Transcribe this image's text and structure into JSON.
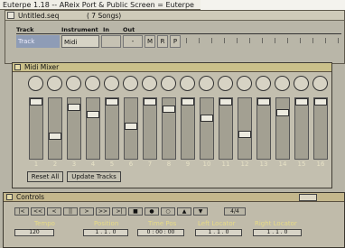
{
  "titlebar": {
    "text": "Euterpe 1.18 -- AReix Port & Public Screen = Euterpe"
  },
  "sequence_window": {
    "title": "Untitled.seq",
    "song_count": "( 7 Songs)",
    "columns": {
      "track": "Track",
      "instrument": "Instrument",
      "in": "In",
      "out": "Out"
    },
    "row": {
      "track_name": "Track",
      "instrument": "Midi",
      "out_value": "-",
      "flags": [
        "M",
        "R",
        "P"
      ]
    }
  },
  "mixer": {
    "title": "Midi Mixer",
    "channel_labels": [
      "1",
      "2",
      "3",
      "4",
      "5",
      "6",
      "7",
      "8",
      "9",
      "10",
      "11",
      "12",
      "13",
      "14",
      "15",
      "16"
    ],
    "buttons": {
      "reset_all": "Reset All",
      "update_tracks": "Update Tracks"
    }
  },
  "controls": {
    "title": "Controls",
    "transport_symbols": [
      "|<",
      "<<",
      "<",
      "||",
      ">",
      ">>",
      ">|",
      "■",
      "●",
      "○",
      "▲",
      "▼",
      "4/4"
    ],
    "labels": {
      "tempo": "Tempo",
      "position": "Position",
      "time_pos": "Time Pos",
      "left_locator": "Left Locator",
      "right_locator": "Right Locator"
    },
    "values": {
      "tempo": "120",
      "position": "1 . 1 . 0",
      "time_pos": "0 : 00 : 00",
      "left_locator": "1 . 1 . 0",
      "right_locator": "1 . 1 . 0"
    }
  }
}
